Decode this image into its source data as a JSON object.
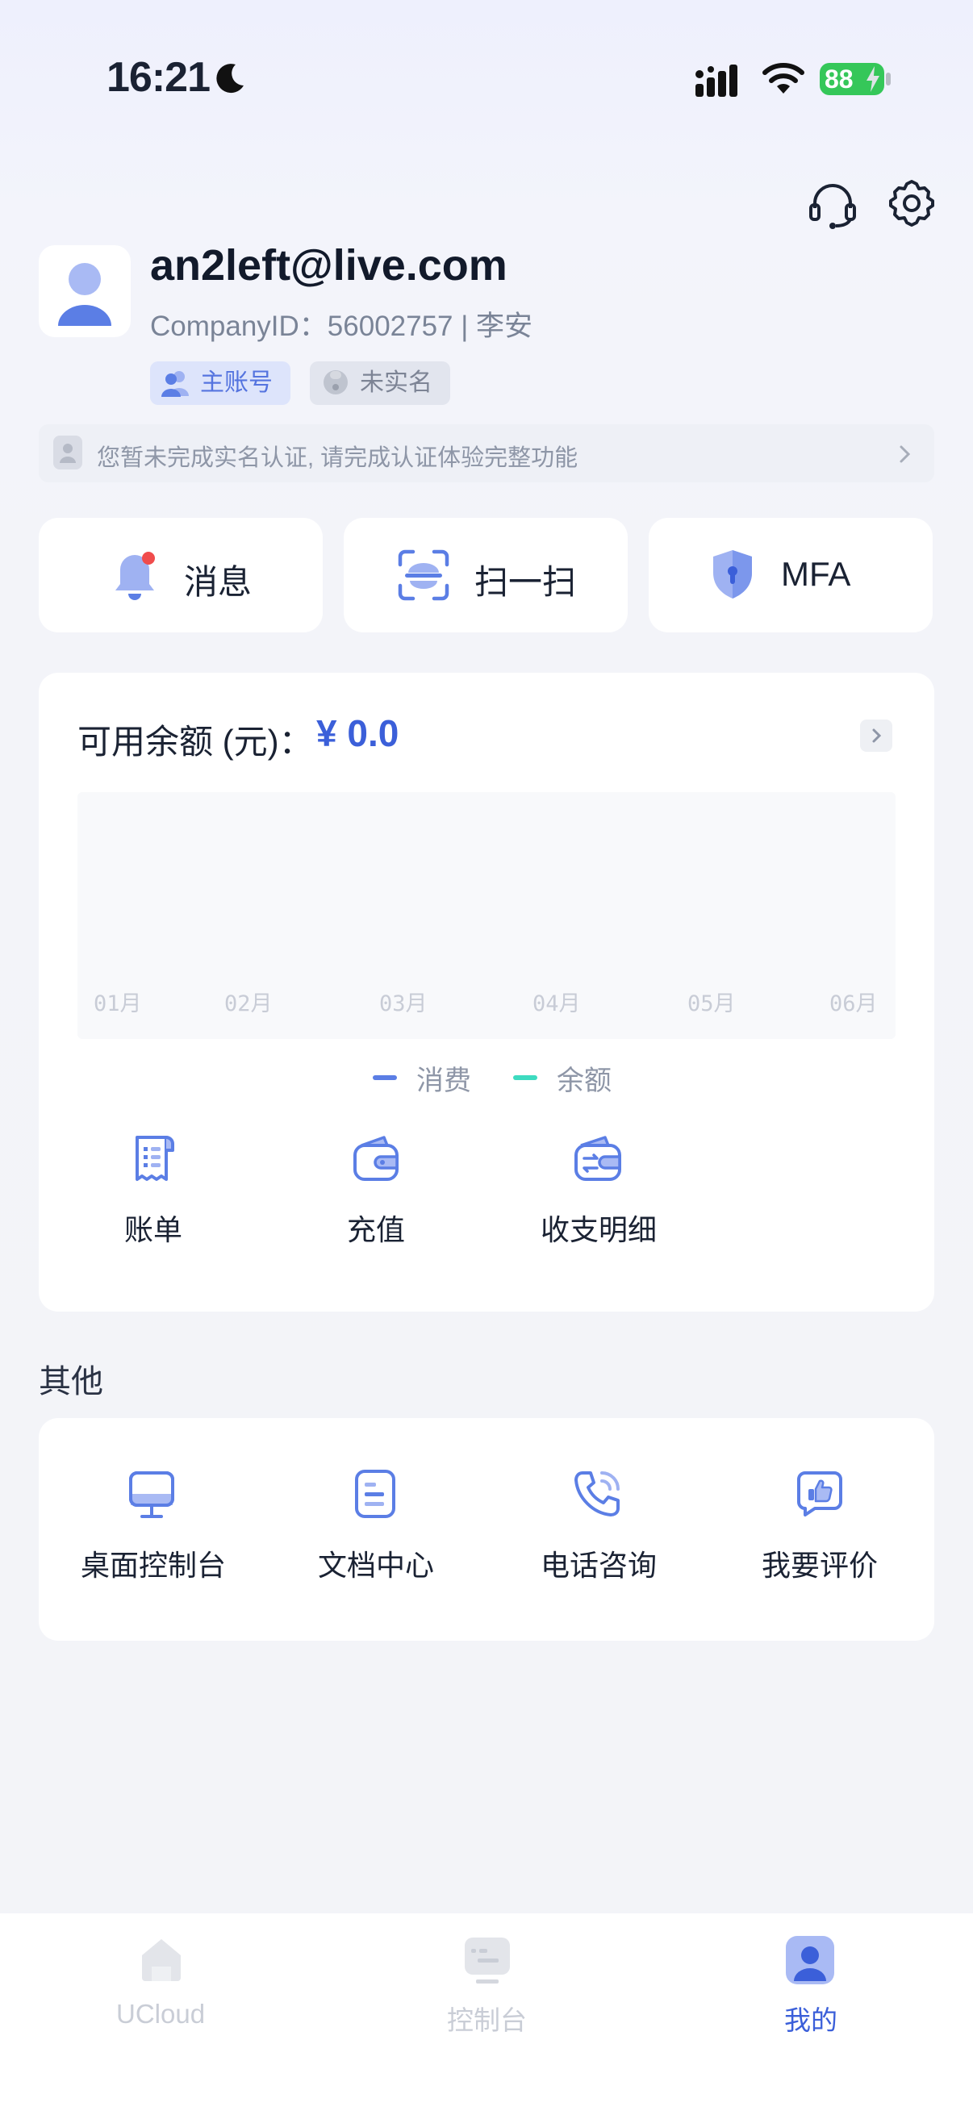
{
  "status_bar": {
    "time": "16:21",
    "battery": "88"
  },
  "profile": {
    "email": "an2left@live.com",
    "company_line": "CompanyID：56002757 | 李安",
    "tags": {
      "main_account": "主账号",
      "unverified": "未实名"
    },
    "notice": "您暂未完成实名认证, 请完成认证体验完整功能"
  },
  "quick_actions": {
    "messages": "消息",
    "scan": "扫一扫",
    "mfa": "MFA"
  },
  "balance": {
    "label": "可用余额 (元)：",
    "amount": "¥ 0.0",
    "actions": {
      "bill": "账单",
      "recharge": "充值",
      "details": "收支明细"
    }
  },
  "chart_data": {
    "type": "line",
    "categories": [
      "01月",
      "02月",
      "03月",
      "04月",
      "05月",
      "06月"
    ],
    "series": [
      {
        "name": "消费",
        "color": "#5b7ee5",
        "values": []
      },
      {
        "name": "余额",
        "color": "#3ddbc0",
        "values": []
      }
    ]
  },
  "other": {
    "title": "其他",
    "items": {
      "desktop": "桌面控制台",
      "docs": "文档中心",
      "phone": "电话咨询",
      "review": "我要评价"
    }
  },
  "tabbar": {
    "ucloud": "UCloud",
    "console": "控制台",
    "mine": "我的"
  },
  "colors": {
    "accent": "#3b5fd9",
    "tab_inactive": "#c9cdd6"
  }
}
